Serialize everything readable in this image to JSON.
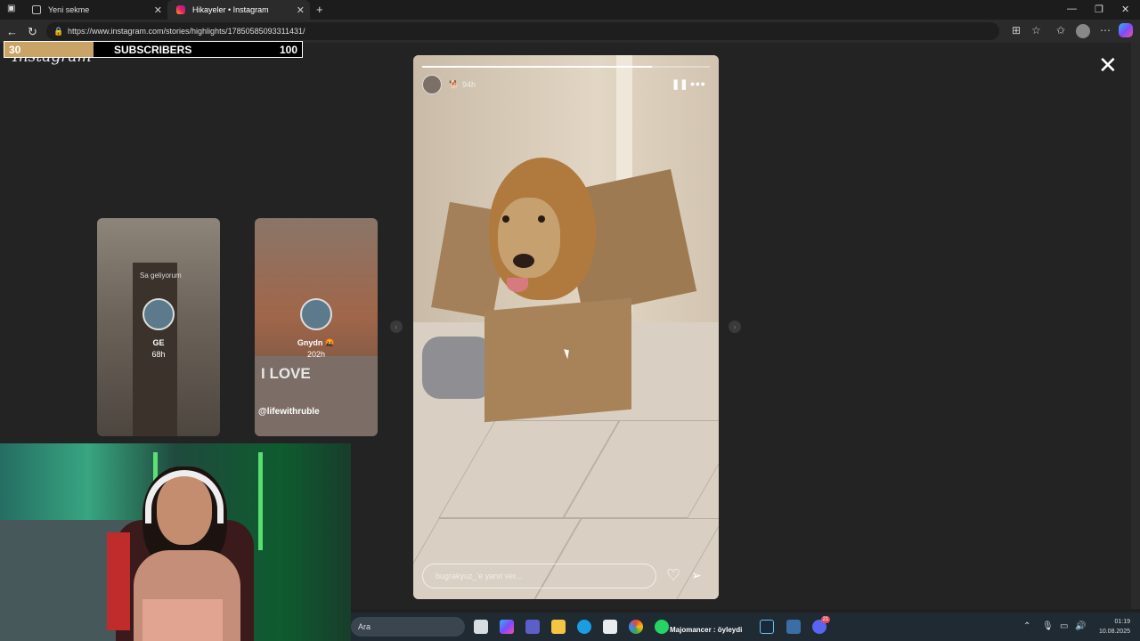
{
  "browser": {
    "tabs": [
      {
        "label": "Yeni sekme"
      },
      {
        "label": "Hikayeler • Instagram"
      }
    ],
    "new_tab_symbol": "+",
    "url": "https://www.instagram.com/stories/highlights/17850585093311431/"
  },
  "overlay": {
    "subscribers_label": "SUBSCRIBERS",
    "current": "30",
    "goal": "100",
    "progress_fraction": 0.3,
    "bar_color": "#c9a466"
  },
  "instagram": {
    "logo": "Instagram"
  },
  "stories": {
    "previews": [
      {
        "note": "Sa geliyorum",
        "name": "GE",
        "time": "68h"
      },
      {
        "name": "Gnydn 🤬",
        "time": "202h",
        "caption": "I LOVE",
        "handle": "@lifewithruble"
      }
    ],
    "active": {
      "badge": "🐕",
      "time": "94h",
      "progress_fraction": 0.8,
      "reply_placeholder": "bugrakyuz_'e yanıt ver...",
      "pause_symbol": "❚❚",
      "more_symbol": "•••",
      "heart_symbol": "♡",
      "send_symbol": "➢"
    },
    "close_symbol": "✕"
  },
  "icons": {
    "back": "back-arrow-icon",
    "refresh": "refresh-icon",
    "lock": "lock-icon",
    "close": "close-icon",
    "pause": "pause-icon",
    "more": "more-icon",
    "heart": "heart-icon",
    "send": "send-icon"
  },
  "taskbar": {
    "search": "Ara",
    "running_label": "Majomancer : öyleydi",
    "time": "01:19",
    "date": "10.08.2025",
    "discord_badge": "21"
  }
}
